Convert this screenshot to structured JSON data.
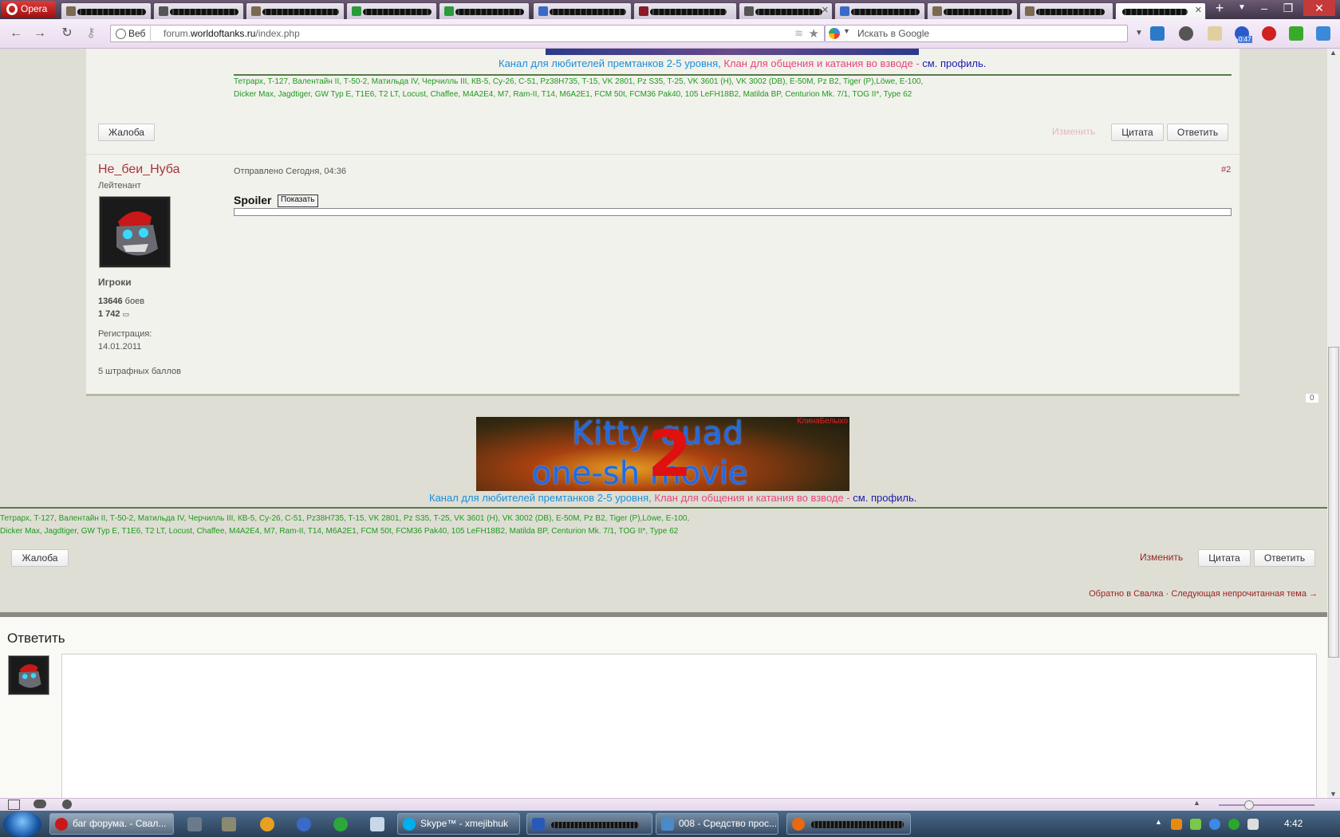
{
  "browser": {
    "menu_label": "Opera",
    "tabs_count": 13,
    "address": {
      "chip_label": "Веб",
      "url_prefix": "forum.",
      "url_domain": "worldoftanks.ru",
      "url_path": "/index.php"
    },
    "search": {
      "placeholder": "Искать в Google"
    },
    "mail_badge": "0:47"
  },
  "signature": {
    "line_blue": "Канал для любителей премтанков 2-5 уровня,",
    "line_pink": "Клан для общения и катания во взводе -",
    "line_see": "см.",
    "line_profile": "профиль.",
    "tanks_line1": "Тетрарх, T-127, Валентайн II, Т-50-2, Матильда IV, Черчилль III, КВ-5, Су-26, С-51, Pz38H735, T-15, VK 2801, Pz S35, T-25, VK 3601 (H), VK 3002 (DB), E-50M, Pz B2, Tiger (P),Löwe, E-100,",
    "tanks_line2": "Dicker Max, Jagdtiger, GW Typ E, T1E6, T2 LT, Locust, Chaffee, M4A2E4, M7, Ram-II, T14, M6A2E1, FCM 50t, FCM36 Pak40, 105 LeFH18B2, Matilda BP, Centurion Mk. 7/1, TOG II*, Type 62"
  },
  "post1": {
    "report": "Жалоба",
    "edit": "Изменить",
    "quote": "Цитата",
    "reply": "Ответить"
  },
  "post2": {
    "author": "Не_беи_Нуба",
    "rank": "Лейтенант",
    "group": "Игроки",
    "battles_count": "13646",
    "battles_label": "боев",
    "posts_count": "1 742",
    "reg_label": "Регистрация:",
    "reg_date": "14.01.2011",
    "penalty": "5 штрафных баллов",
    "posted": "Отправлено Сегодня, 04:36",
    "number": "#2",
    "spoiler_title": "Spoiler",
    "spoiler_button": "Показать"
  },
  "banner": {
    "line1": "Kitty quad",
    "line2": "one-sh  movie",
    "number": "2",
    "tag": "КлинаБелыхо"
  },
  "comment_count": "0",
  "post3": {
    "report": "Жалоба",
    "edit": "Изменить",
    "quote": "Цитата",
    "reply": "Ответить"
  },
  "nav": {
    "back": "Обратно в Свалка",
    "sep": "·",
    "next": "Следующая непрочитанная тема →"
  },
  "reply_form": {
    "title": "Ответить"
  },
  "taskbar": {
    "tasks": [
      "баг форума. - Свал...",
      "Skype™ - xmejibhuk",
      "008 - Средство прос..."
    ],
    "clock": "4:42"
  },
  "colors": {
    "accent_red": "#a8323a",
    "sig_blue": "#1c8fd8",
    "sig_pink": "#e8457a",
    "tanks_green": "#1f9a1f"
  }
}
